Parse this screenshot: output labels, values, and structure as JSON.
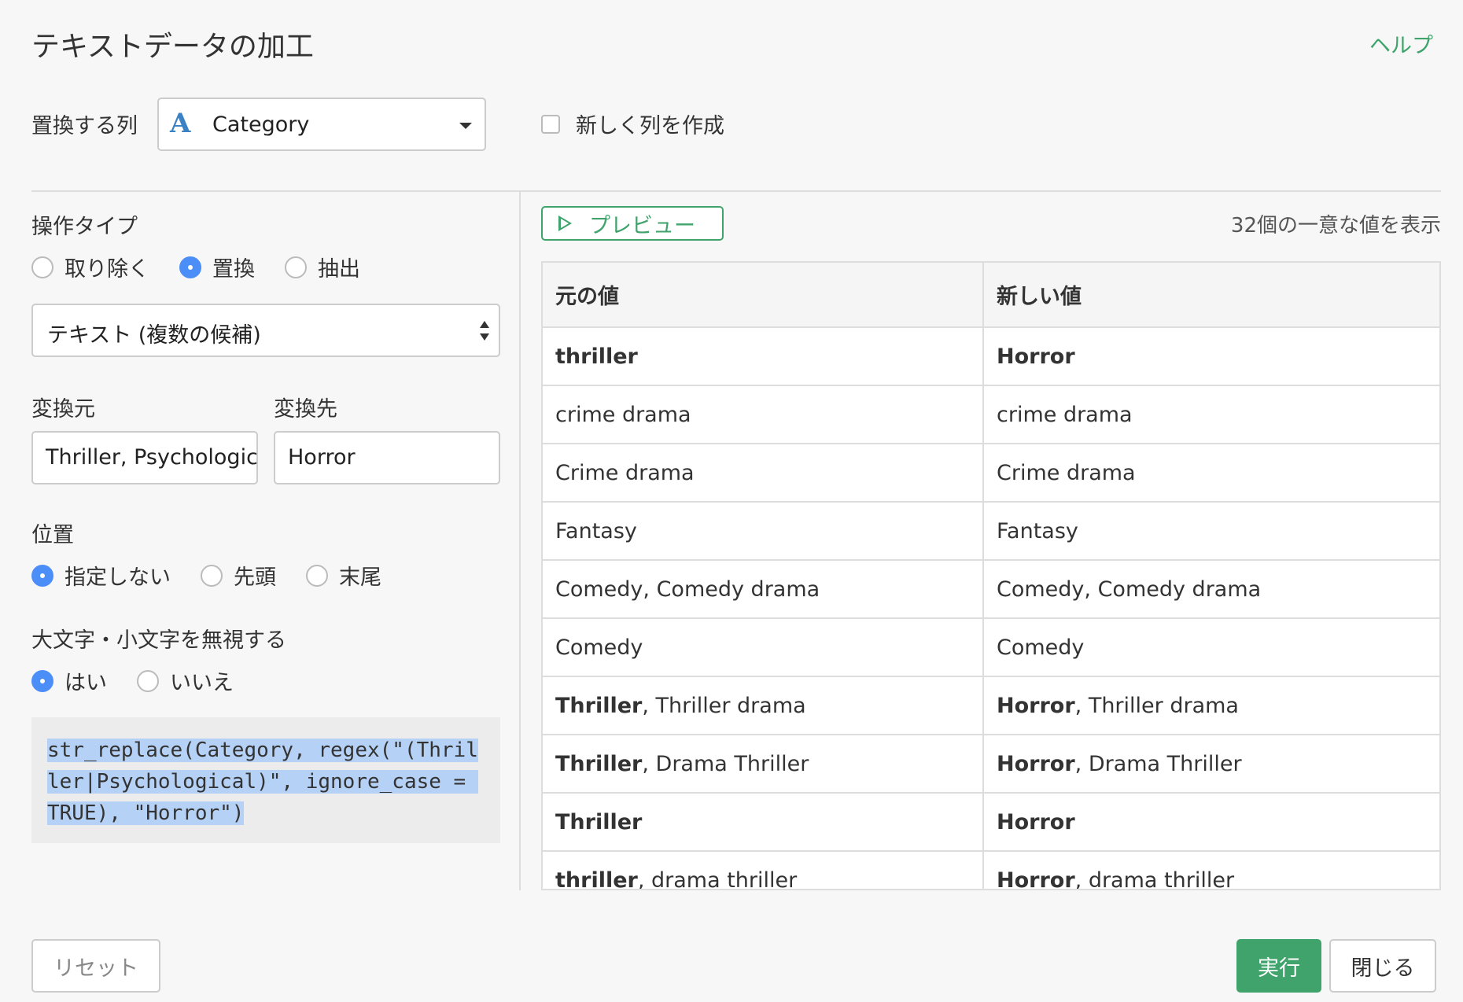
{
  "header": {
    "title": "テキストデータの加工",
    "help": "ヘルプ"
  },
  "column_select": {
    "label": "置換する列",
    "type_icon": "A",
    "value": "Category",
    "new_column_label": "新しく列を作成"
  },
  "operation": {
    "label": "操作タイプ",
    "options": [
      "取り除く",
      "置換",
      "抽出"
    ],
    "selected": "置換"
  },
  "match_type": {
    "value": "テキスト (複数の候補)"
  },
  "replace": {
    "from_label": "変換元",
    "from_value": "Thriller, Psychologic",
    "to_label": "変換先",
    "to_value": "Horror"
  },
  "position": {
    "label": "位置",
    "options": [
      "指定しない",
      "先頭",
      "末尾"
    ],
    "selected": "指定しない"
  },
  "ignore_case": {
    "label": "大文字・小文字を無視する",
    "options": [
      "はい",
      "いいえ"
    ],
    "selected": "はい"
  },
  "code": "str_replace(Category, regex(\"(Thriller|Psychological)\", ignore_case = TRUE), \"Horror\")",
  "preview": {
    "button_label": "プレビュー",
    "unique_count": "32個の一意な値を表示"
  },
  "table": {
    "headers": [
      "元の値",
      "新しい値"
    ],
    "rows": [
      {
        "orig_bold": "thriller",
        "orig_rest": "",
        "new_bold": "Horror",
        "new_rest": ""
      },
      {
        "orig_bold": "",
        "orig_rest": "crime drama",
        "new_bold": "",
        "new_rest": "crime drama"
      },
      {
        "orig_bold": "",
        "orig_rest": "Crime drama",
        "new_bold": "",
        "new_rest": "Crime drama"
      },
      {
        "orig_bold": "",
        "orig_rest": "Fantasy",
        "new_bold": "",
        "new_rest": "Fantasy"
      },
      {
        "orig_bold": "",
        "orig_rest": "Comedy, Comedy drama",
        "new_bold": "",
        "new_rest": "Comedy, Comedy drama"
      },
      {
        "orig_bold": "",
        "orig_rest": "Comedy",
        "new_bold": "",
        "new_rest": "Comedy"
      },
      {
        "orig_bold": "Thriller",
        "orig_rest": ", Thriller drama",
        "new_bold": "Horror",
        "new_rest": ", Thriller drama"
      },
      {
        "orig_bold": "Thriller",
        "orig_rest": ", Drama Thriller",
        "new_bold": "Horror",
        "new_rest": ", Drama Thriller"
      },
      {
        "orig_bold": "Thriller",
        "orig_rest": "",
        "new_bold": "Horror",
        "new_rest": ""
      },
      {
        "orig_bold": "thriller",
        "orig_rest": ", drama thriller",
        "new_bold": "Horror",
        "new_rest": ", drama thriller"
      }
    ]
  },
  "footer": {
    "reset": "リセット",
    "run": "実行",
    "close": "閉じる"
  },
  "colors": {
    "accent_green": "#3fa36b",
    "radio_blue": "#4c8ef7",
    "type_icon_blue": "#3b82c4",
    "code_highlight": "#b5d1f5"
  }
}
